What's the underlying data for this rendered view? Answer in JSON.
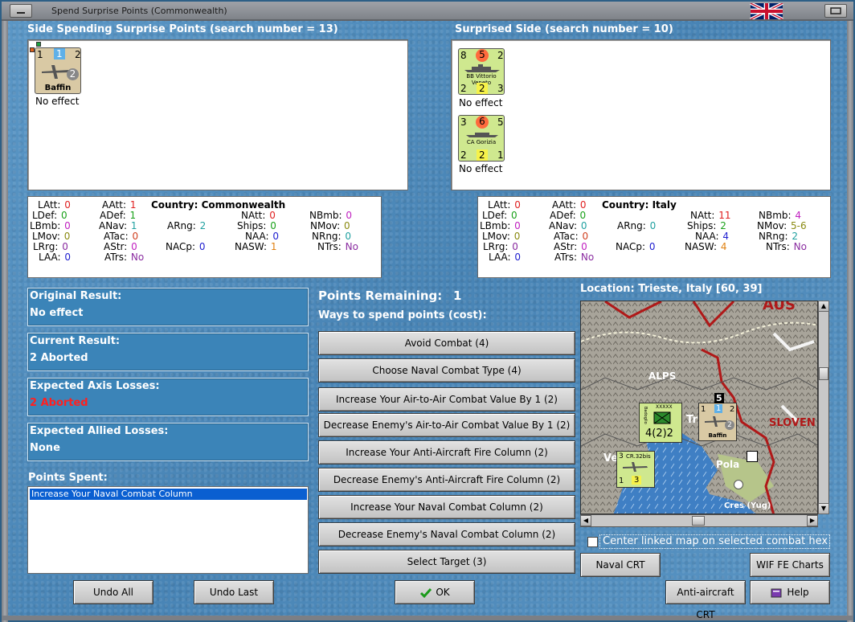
{
  "window": {
    "title": "Spend Surprise Points (Commonwealth)"
  },
  "left_side": {
    "header": "Side Spending Surprise Points (search number = 13)",
    "units": [
      {
        "name": "Baffin",
        "top_left": "1",
        "top_mid": "1",
        "top_right": "2",
        "badge": "2",
        "effect": "No effect"
      }
    ]
  },
  "right_side": {
    "header": "Surprised Side (search number = 10)",
    "units": [
      {
        "name": "BB Vittorio Veneto",
        "tl": "8",
        "tm": "5",
        "tr": "2",
        "bl": "2",
        "bm": "2",
        "br": "3",
        "effect": "No effect"
      },
      {
        "name": "CA Gorizia",
        "tl": "3",
        "tm": "6",
        "tr": "5",
        "bl": "2",
        "bm": "2",
        "br": "1",
        "effect": "No effect"
      }
    ]
  },
  "stats_left": {
    "country_label": "Country: Commonwealth",
    "LAtt": "0",
    "AAtt": "1",
    "NAtt": "0",
    "NBmb": "0",
    "LDef": "0",
    "ADef": "1",
    "Ships": "0",
    "NMov": "0",
    "LBmb": "0",
    "ANav": "1",
    "ARng": "2",
    "NAA": "0",
    "NRng": "0",
    "LMov": "0",
    "ATac": "0",
    "LRrg": "0",
    "AStr": "0",
    "NACp": "0",
    "NASW": "1",
    "NTrs": "No",
    "LAA": "0",
    "ATrs": "No"
  },
  "stats_right": {
    "country_label": "Country: Italy",
    "LAtt": "0",
    "AAtt": "0",
    "NAtt": "11",
    "NBmb": "4",
    "LDef": "0",
    "ADef": "0",
    "Ships": "2",
    "NMov": "5-6",
    "LBmb": "0",
    "ANav": "0",
    "ARng": "0",
    "NAA": "4",
    "NRng": "2",
    "LMov": "0",
    "ATac": "0",
    "LRrg": "0",
    "AStr": "0",
    "NACp": "0",
    "NASW": "4",
    "NTrs": "No",
    "LAA": "0",
    "ATrs": "No"
  },
  "results": {
    "original_label": "Original Result:",
    "original_value": "No effect",
    "current_label": "Current Result:",
    "current_value": "2 Aborted",
    "axis_label": "Expected Axis Losses:",
    "axis_value": "2 Aborted",
    "allied_label": "Expected Allied Losses:",
    "allied_value": "None"
  },
  "points_spent": {
    "label": "Points Spent:",
    "items": [
      "Increase Your Naval Combat Column"
    ]
  },
  "points": {
    "remaining_label": "Points Remaining:",
    "remaining_value": "1",
    "ways_label": "Ways to spend points (cost):",
    "options": [
      "Avoid Combat (4)",
      "Choose Naval Combat Type (4)",
      "Increase Your Air-to-Air Combat Value By 1 (2)",
      "Decrease Enemy's Air-to-Air Combat Value By 1 (2)",
      "Increase Your Anti-Aircraft Fire Column (2)",
      "Decrease Enemy's Anti-Aircraft Fire Column (2)",
      "Increase Your Naval Combat Column (2)",
      "Decrease Enemy's Naval Combat Column (2)",
      "Select Target (3)"
    ]
  },
  "map": {
    "location_label": "Location: Trieste, Italy [60, 39]",
    "labels": {
      "alps": "ALPS",
      "aus": "AUS",
      "slov": "SLOVEN",
      "pola": "Pola",
      "cres": "Cres (Yug)",
      "tr": "Tr",
      "ve": "Ve"
    },
    "units": {
      "army": {
        "name": "Badoglio",
        "tag": "XXXXX",
        "value": "4(2)2"
      },
      "air": {
        "name": "CR.32bis",
        "tl": "3",
        "bl": "1",
        "bm": "3"
      },
      "carrier": {
        "name": "Baffin",
        "tl": "1",
        "tm": "1",
        "tr": "2",
        "badge": "2",
        "stack": "5"
      }
    },
    "center_checkbox_label": "Center linked map on selected combat hex"
  },
  "buttons": {
    "undo_all": "Undo All",
    "undo_last": "Undo Last",
    "ok": "OK",
    "naval_crt": "Naval CRT",
    "wif_fe_charts": "WIF FE Charts",
    "aa_crt": "Anti-aircraft CRT",
    "help": "Help"
  }
}
